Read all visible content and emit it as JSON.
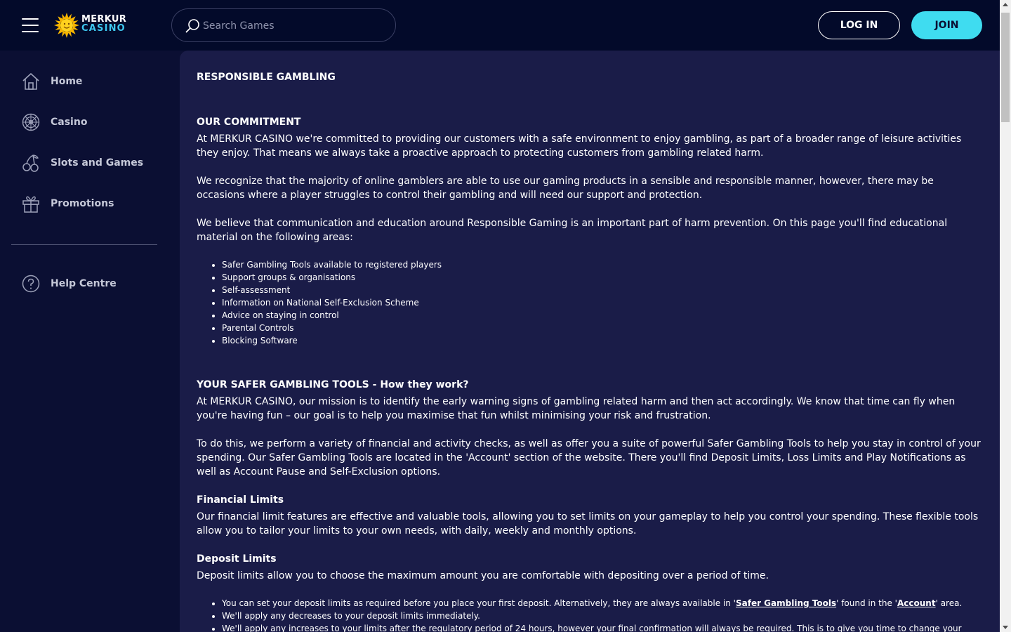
{
  "header": {
    "logo_line1": "MERKUR",
    "logo_line2": "CASINO",
    "search_placeholder": "Search Games",
    "login_label": "LOG IN",
    "join_label": "JOIN"
  },
  "sidebar": {
    "items": [
      {
        "label": "Home",
        "icon": "home-icon"
      },
      {
        "label": "Casino",
        "icon": "roulette-icon"
      },
      {
        "label": "Slots and Games",
        "icon": "cherries-icon"
      },
      {
        "label": "Promotions",
        "icon": "gift-icon"
      }
    ],
    "help": {
      "label": "Help Centre",
      "icon": "help-icon"
    }
  },
  "content": {
    "title": "RESPONSIBLE GAMBLING",
    "commitment_heading": "OUR COMMITMENT",
    "commitment_p1": "At MERKUR CASINO we're committed to providing our customers with a safe environment to enjoy gambling, as part of a broader range of leisure activities they enjoy. That means we always take a proactive approach to protecting customers from gambling related harm.",
    "commitment_p2": "We recognize that the majority of online gamblers are able to use our gaming products in a sensible and responsible manner, however, there may be occasions where a player struggles to control their gambling and will need our support and protection.",
    "commitment_p3": "We believe that communication and education around Responsible Gaming is an important part of harm prevention. On this page you'll find educational material on the following areas:",
    "areas": [
      "Safer Gambling Tools available to registered players",
      "Support groups & organisations",
      "Self-assessment",
      "Information on National Self-Exclusion Scheme",
      "Advice on staying in control",
      "Parental Controls",
      "Blocking Software"
    ],
    "tools_heading": "YOUR SAFER GAMBLING TOOLS - How they work?",
    "tools_p1": "At MERKUR CASINO, our mission is to identify the early warning signs of gambling related harm and then act accordingly. We know that time can fly when you're having fun – our goal is to help you maximise that fun whilst minimising your risk and frustration.",
    "tools_p2": "To do this, we perform a variety of financial and activity checks, as well as offer you a suite of powerful Safer Gambling Tools to help you stay in control of your spending. Our Safer Gambling Tools are located in the 'Account' section of the website. There you'll find Deposit Limits, Loss Limits and Play Notifications as well as Account Pause and Self-Exclusion options.",
    "financial_heading": "Financial Limits",
    "financial_p": "Our financial limit features are effective and valuable tools, allowing you to set limits on your gameplay to help you control your spending. These flexible tools allow you to tailor your limits to your own needs, with daily, weekly and monthly options.",
    "deposit_heading": "Deposit Limits",
    "deposit_p": "Deposit limits allow you to choose the maximum amount you are comfortable with depositing over a period of time.",
    "deposit_b1_pre": "You can set your deposit limits as required before you place your first deposit. Alternatively, they are always available in '",
    "deposit_b1_link1": "Safer Gambling Tools",
    "deposit_b1_mid": "' found in the '",
    "deposit_b1_link2": "Account",
    "deposit_b1_post": "' area.",
    "deposit_b2": "We'll apply any decreases to your deposit limits immediately.",
    "deposit_b3": "We'll apply any increases to your limits after the regulatory period of 24 hours, however your final confirmation will always be required. This is to give you time to change your mind"
  },
  "colors": {
    "page_bg": "#0b0f33",
    "content_bg": "#1a1c48",
    "accent": "#3fdcf0"
  }
}
